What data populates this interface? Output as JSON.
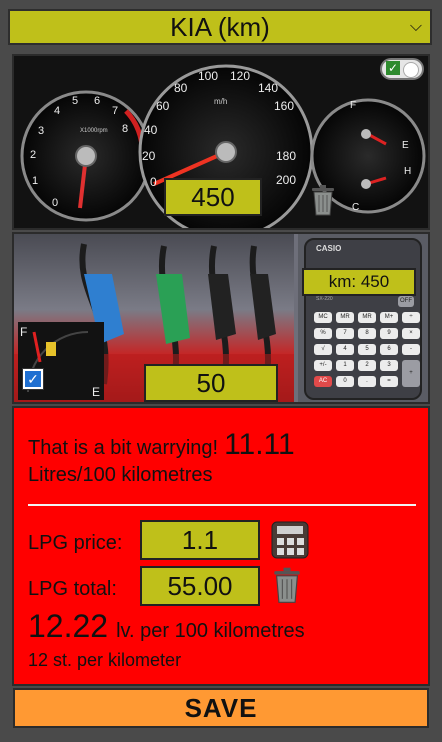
{
  "car_select": {
    "value": "KIA (km)"
  },
  "dashboard": {
    "distance_value": "450",
    "speedo_ticks": [
      "0",
      "20",
      "40",
      "60",
      "80",
      "100",
      "120",
      "140",
      "160",
      "180",
      "200"
    ],
    "speedo_unit": "m/h",
    "tacho_ticks": [
      "0",
      "1",
      "2",
      "3",
      "4",
      "5",
      "6",
      "7",
      "8"
    ],
    "tacho_unit": "X1000rpm",
    "fuel_labels": [
      "F",
      "E"
    ],
    "temp_labels": [
      "H",
      "C"
    ]
  },
  "pumps": {
    "fuel_value": "50",
    "calc_brand": "CASIO",
    "calc_display": "km: 450",
    "calc_model": "SX-220",
    "calc_keys": [
      "MC",
      "MR",
      "MR",
      "M+",
      "÷",
      "%",
      "7",
      "8",
      "9",
      "×",
      "√",
      "4",
      "5",
      "6",
      "-",
      "+/-",
      "1",
      "2",
      "3",
      "+",
      "AC",
      "0",
      ".",
      "="
    ],
    "gauge_labels": [
      "F",
      "E"
    ],
    "gauge_checked": true
  },
  "result": {
    "message": "That is a bit warrying!",
    "consumption_value": "11.11",
    "consumption_unit": "Litres/100 kilometres",
    "lpg_price_label": "LPG price:",
    "lpg_price_value": "1.1",
    "lpg_total_label": "LPG total:",
    "lpg_total_value": "55.00",
    "cost_value": "12.22",
    "cost_unit": "lv. per 100 kilometres",
    "per_km_text": "12 st. per kilometer"
  },
  "save_label": "SAVE",
  "colors": {
    "accent_yellow": "#bfc01a",
    "result_red": "#ff0000",
    "save_orange": "#ff9933",
    "frame_grey": "#4a4a4a"
  },
  "icons": [
    "chevron-down-icon",
    "toggle-icon",
    "trash-icon",
    "calculator-icon",
    "fuel-pump-icon",
    "checkbox-icon"
  ]
}
